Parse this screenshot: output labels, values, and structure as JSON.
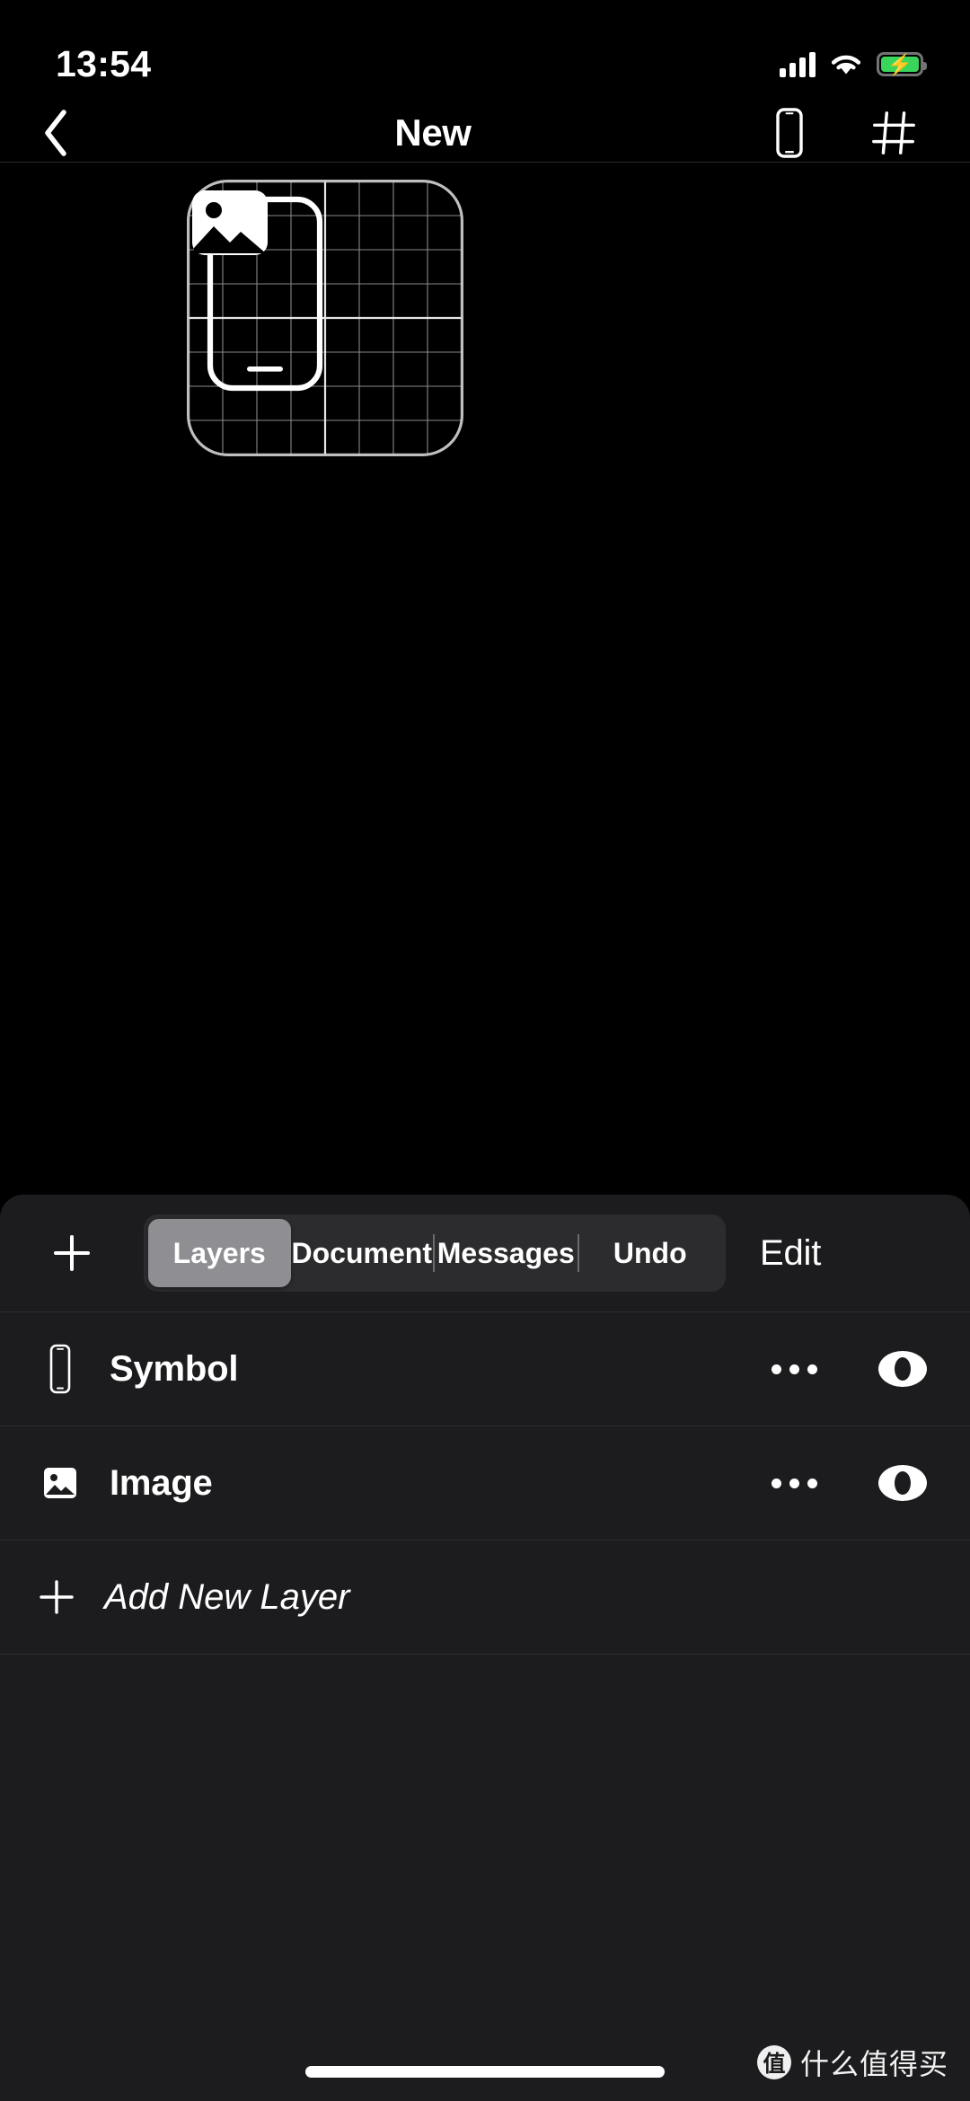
{
  "status_bar": {
    "time": "13:54",
    "signal_icon": "cellular-signal-icon",
    "wifi_icon": "wifi-icon",
    "battery_icon": "battery-charging-icon",
    "battery_color": "#3ad65b",
    "battery_bolt": "⚡"
  },
  "nav_bar": {
    "back_icon": "chevron-left-icon",
    "title": "New",
    "device_icon": "iphone-icon",
    "grid_icon": "grid-hash-icon"
  },
  "canvas": {
    "artboard_name": "artboard-preview",
    "grid_color": "#c9c9c9",
    "layers_rendered": [
      "phone-symbol-outline",
      "photo-image-icon"
    ]
  },
  "toolbar": {
    "add_label": "+",
    "segments": [
      {
        "label": "Layers",
        "selected": true
      },
      {
        "label": "Document",
        "selected": false
      },
      {
        "label": "Messages",
        "selected": false
      },
      {
        "label": "Undo",
        "selected": false
      }
    ],
    "selected_color": "#8e8e93",
    "edit_label": "Edit"
  },
  "layers": {
    "rows": [
      {
        "icon": "iphone-icon",
        "name": "Symbol",
        "menu": "more-options-icon",
        "visibility": "eye-visible-icon"
      },
      {
        "icon": "photo-icon",
        "name": "Image",
        "menu": "more-options-icon",
        "visibility": "eye-visible-icon"
      }
    ],
    "add_new": {
      "icon": "plus-icon",
      "label": "Add New Layer"
    }
  },
  "footer": {
    "home_indicator": "home-indicator",
    "watermark_logo": "值",
    "watermark_text": "什么值得买"
  }
}
